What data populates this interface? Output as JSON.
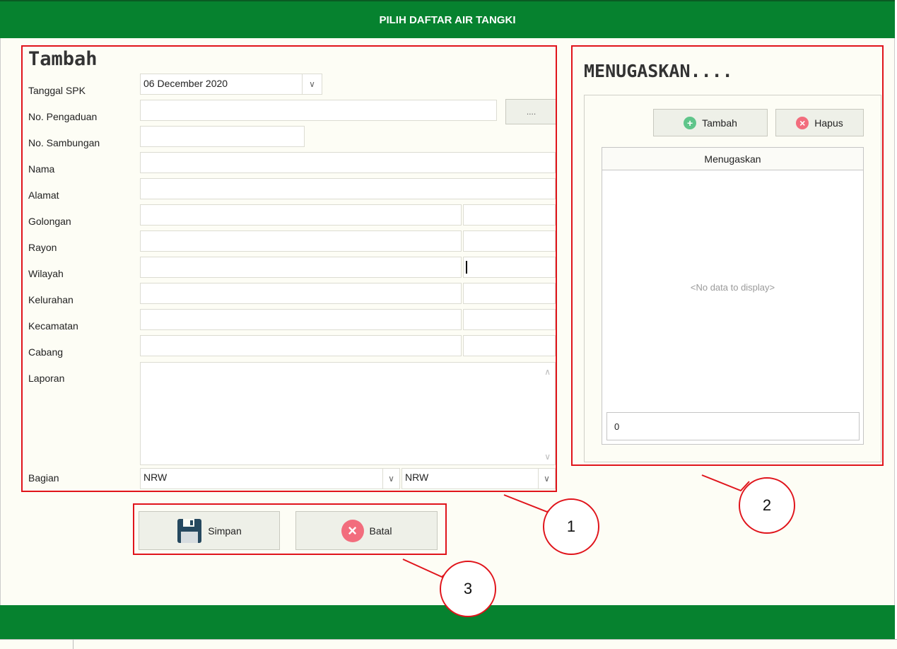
{
  "header": {
    "title": "PILIH DAFTAR AIR TANGKI"
  },
  "form": {
    "title": "Tambah",
    "tanggal_spk": {
      "label": "Tanggal SPK",
      "value": "06 December 2020"
    },
    "no_pengaduan": {
      "label": "No. Pengaduan",
      "value": "",
      "browse_label": "...."
    },
    "no_sambungan": {
      "label": "No. Sambungan",
      "value": ""
    },
    "nama": {
      "label": "Nama",
      "value": ""
    },
    "alamat": {
      "label": "Alamat",
      "value": ""
    },
    "golongan": {
      "label": "Golongan",
      "value": "",
      "code": ""
    },
    "rayon": {
      "label": "Rayon",
      "value": "",
      "code": ""
    },
    "wilayah": {
      "label": "Wilayah",
      "value": "",
      "code": ""
    },
    "kelurahan": {
      "label": "Kelurahan",
      "value": "",
      "code": ""
    },
    "kecamatan": {
      "label": "Kecamatan",
      "value": "",
      "code": ""
    },
    "cabang": {
      "label": "Cabang",
      "value": "",
      "code": ""
    },
    "laporan": {
      "label": "Laporan",
      "value": ""
    },
    "bagian": {
      "label": "Bagian",
      "value1": "NRW",
      "value2": "NRW"
    }
  },
  "assign": {
    "title": "MENUGASKAN....",
    "add_label": "Tambah",
    "delete_label": "Hapus",
    "column_header": "Menugaskan",
    "empty_text": "<No data to display>",
    "footer_value": "0"
  },
  "actions": {
    "save_label": "Simpan",
    "cancel_label": "Batal"
  },
  "callouts": [
    "1",
    "2",
    "3"
  ],
  "colors": {
    "header_green": "#06822f",
    "highlight_red": "#e0141b",
    "add_icon": "#5fc58a",
    "cancel_icon": "#f26d7d",
    "save_icon": "#26495f"
  }
}
